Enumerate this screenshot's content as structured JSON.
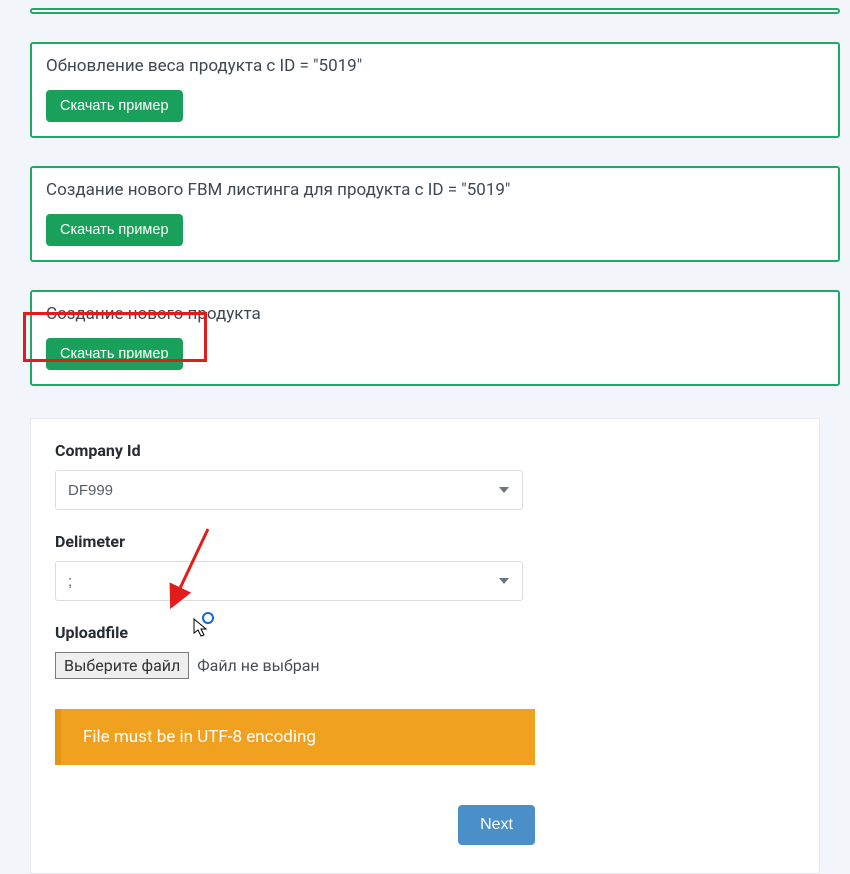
{
  "panels": [
    {
      "title": "Обновление веса продукта с ID = \"5019\"",
      "button": "Скачать пример"
    },
    {
      "title": "Создание нового FBM листинга для продукта с ID = \"5019\"",
      "button": "Скачать пример"
    },
    {
      "title": "Создание нового продукта",
      "button": "Скачать пример"
    }
  ],
  "form": {
    "company_id": {
      "label": "Company Id",
      "value": "DF999"
    },
    "delimiter": {
      "label": "Delimeter",
      "value": ";"
    },
    "upload": {
      "label": "Uploadfile",
      "button": "Выберите файл",
      "status": "Файл не выбран"
    },
    "alert": "File must be in UTF-8 encoding",
    "next": "Next"
  }
}
